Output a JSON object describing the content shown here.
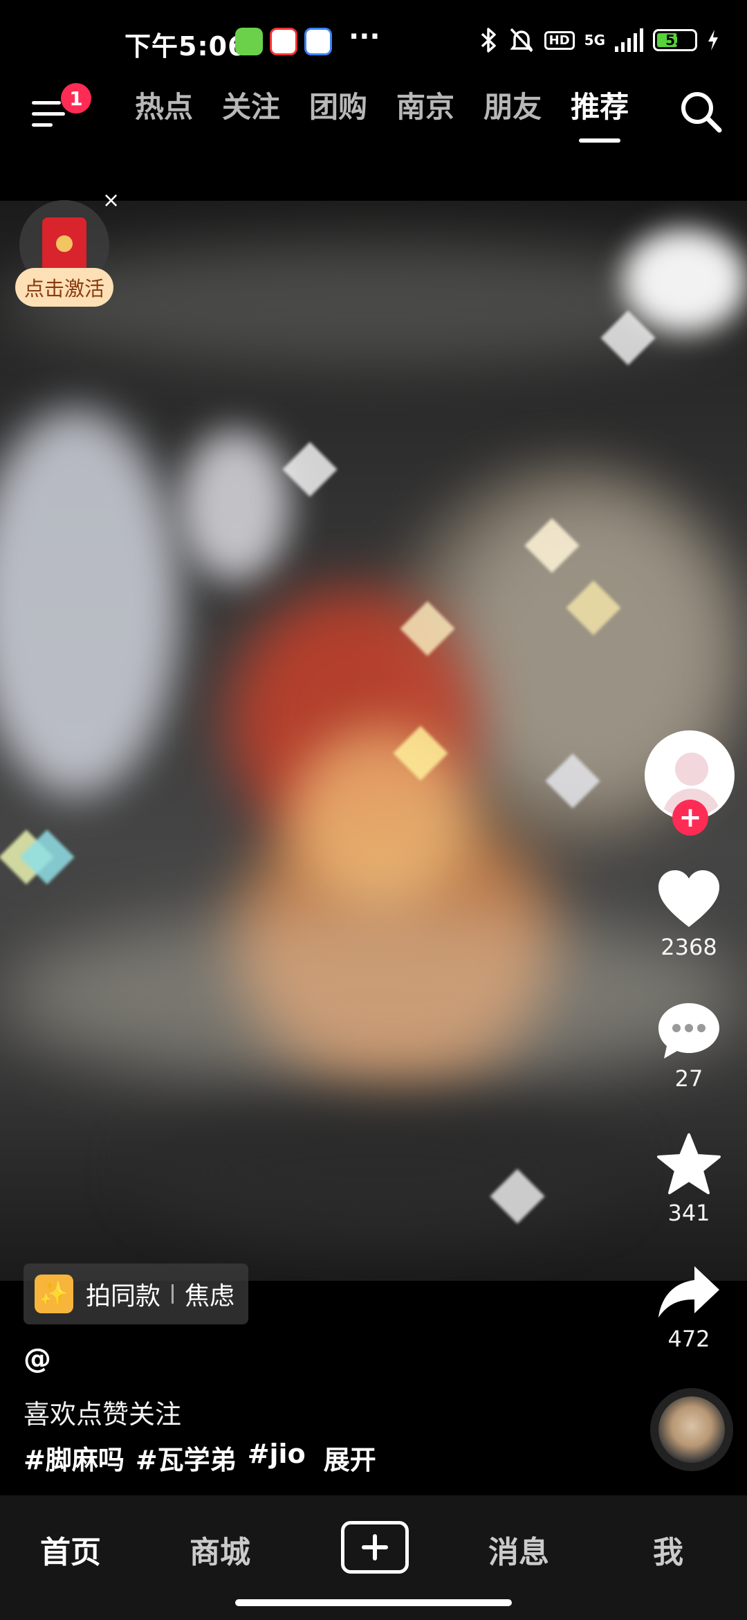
{
  "status_bar": {
    "time": "下午5:06",
    "network": "5G",
    "hd_label": "HD",
    "battery_percent": "53",
    "icons": [
      "app-green-icon",
      "app-58-icon",
      "app-blue-icon",
      "more-dots",
      "bluetooth-icon",
      "mute-bell-icon",
      "hd-icon",
      "signal-icon",
      "battery-icon",
      "charging-icon"
    ],
    "more": "···"
  },
  "top_nav": {
    "menu_badge": "1",
    "tabs": [
      {
        "label": "热点"
      },
      {
        "label": "关注"
      },
      {
        "label": "团购"
      },
      {
        "label": "南京"
      },
      {
        "label": "朋友"
      },
      {
        "label": "推荐"
      }
    ],
    "active_tab": "推荐"
  },
  "red_packet": {
    "label": "点击激活",
    "close": "×"
  },
  "actions": {
    "follow_symbol": "+",
    "likes": "2368",
    "comments": "27",
    "favorites": "341",
    "shares": "472"
  },
  "video_info": {
    "template_label": "拍同款",
    "template_tag": "焦虑",
    "author": "@",
    "description": "喜欢点赞关注",
    "hashtags": [
      "#脚麻吗",
      "#瓦学弟",
      "#jio"
    ],
    "expand_label": "展开"
  },
  "bottom_nav": {
    "home": "首页",
    "mall": "商城",
    "messages": "消息",
    "me": "我"
  },
  "colors": {
    "accent_red": "#fe2c55",
    "battery_green": "#56d33b",
    "nav_bg": "#161616"
  }
}
